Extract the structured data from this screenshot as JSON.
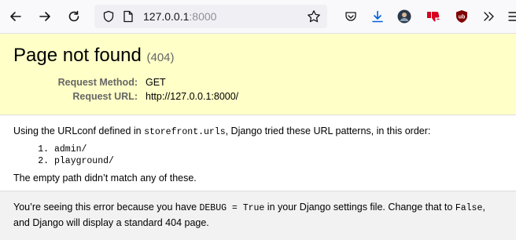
{
  "browser": {
    "url_host": "127.0.0.1",
    "url_port": ":8000",
    "icons": [
      "back-icon",
      "forward-icon",
      "reload-icon",
      "shield-icon",
      "page-icon",
      "star-icon",
      "pocket-icon",
      "download-icon",
      "avatar",
      "dislike-icon",
      "ublock-icon",
      "overflow-icon"
    ],
    "ublock_badge": "ub",
    "accent": "#0060df"
  },
  "summary": {
    "title": "Page not found",
    "status_code": "(404)",
    "method_label": "Request Method:",
    "method_value": "GET",
    "url_label": "Request URL:",
    "url_value": "http://127.0.0.1:8000/"
  },
  "info": {
    "intro_prefix": "Using the URLconf defined in ",
    "urlconf": "storefront.urls",
    "intro_suffix": ", Django tried these URL patterns, in this order:",
    "patterns": [
      "admin/",
      "playground/"
    ],
    "no_match": "The empty path didn’t match any of these."
  },
  "explanation": {
    "part1": "You’re seeing this error because you have ",
    "debug_code": "DEBUG = True",
    "part2": " in your Django settings file. Change that to ",
    "false_code": "False",
    "part3": ", and Django will display a standard 404 page."
  }
}
